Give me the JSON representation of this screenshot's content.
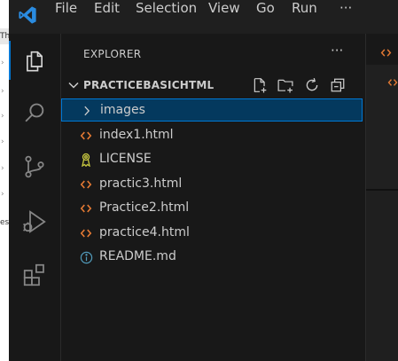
{
  "background_window": {
    "text1": "Th",
    "text2": "es"
  },
  "menu": [
    "File",
    "Edit",
    "Selection",
    "View",
    "Go",
    "Run",
    "···"
  ],
  "explorer": {
    "title": "EXPLORER",
    "more": "···",
    "folder": "PRACTICEBASICHTML",
    "items": [
      {
        "label": "images",
        "icon": "chevron-right-icon"
      },
      {
        "label": "index1.html",
        "icon": "html-file-icon"
      },
      {
        "label": "LICENSE",
        "icon": "license-file-icon"
      },
      {
        "label": "practic3.html",
        "icon": "html-file-icon"
      },
      {
        "label": "Practice2.html",
        "icon": "html-file-icon"
      },
      {
        "label": "practice4.html",
        "icon": "html-file-icon"
      },
      {
        "label": "README.md",
        "icon": "info-icon"
      }
    ]
  },
  "colors": {
    "accent": "#0078d4",
    "selection": "#04395e",
    "html_icon": "#e37933",
    "license_icon": "#cbcb41",
    "info_icon": "#519aba"
  }
}
